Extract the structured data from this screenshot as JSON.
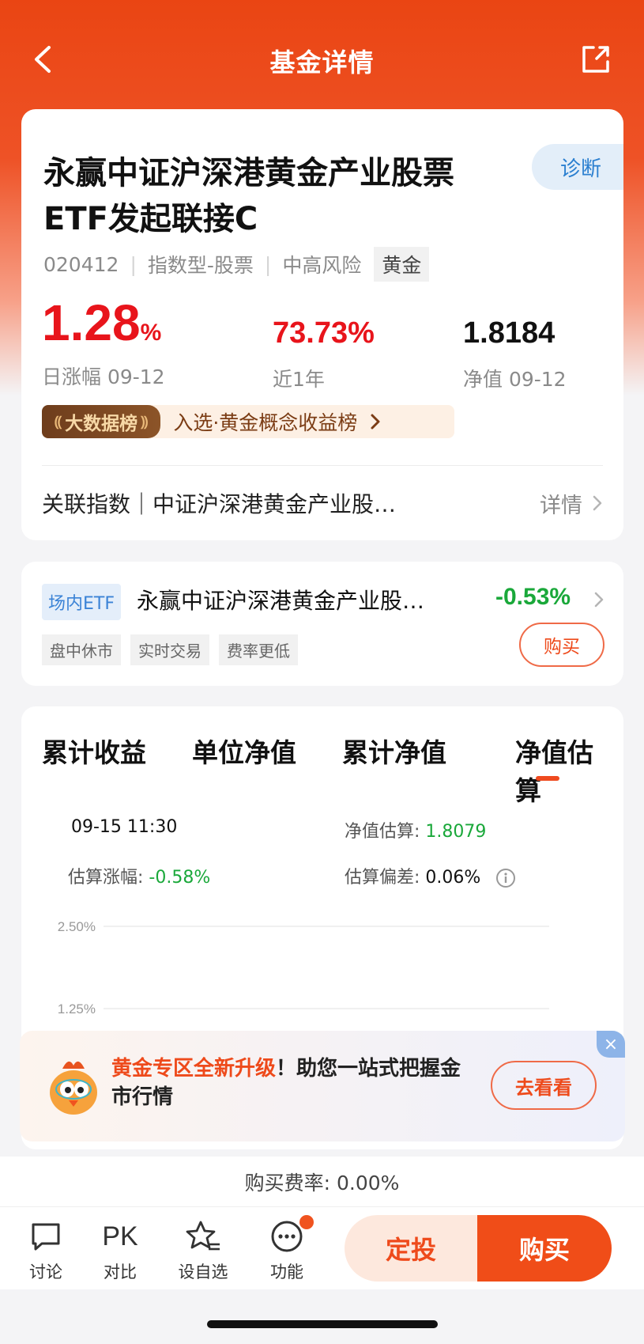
{
  "header": {
    "title": "基金详情"
  },
  "fund": {
    "name_line1": "永赢中证沪深港黄金产业股票",
    "name_line2": "ETF发起联接C",
    "diagnose": "诊断",
    "code": "020412",
    "type": "指数型-股票",
    "risk": "中高风险",
    "tag": "黄金",
    "daily_change": "1.28",
    "daily_change_unit": "%",
    "daily_label": "日涨幅 09-12",
    "year_return": "73.73%",
    "year_label": "近1年",
    "nav": "1.8184",
    "nav_label": "净值 09-12",
    "rank_badge": "大数据榜",
    "rank_text": "入选·黄金概念收益榜",
    "index_label": "关联指数｜中证沪深港黄金产业股…",
    "index_detail": "详情"
  },
  "etf": {
    "tag": "场内ETF",
    "name": "永赢中证沪深港黄金产业股…",
    "change": "-0.53%",
    "mini_tags": [
      "盘中休市",
      "实时交易",
      "费率更低"
    ],
    "buy": "购买"
  },
  "tabs": [
    "累计收益",
    "单位净值",
    "累计净值",
    "净值估算"
  ],
  "estimate": {
    "time": "09-15 11:30",
    "nav_label": "净值估算: ",
    "nav_value": "1.8079",
    "change_label": "估算涨幅: ",
    "change_value": "-0.58%",
    "dev_label": "估算偏差: ",
    "dev_value": "0.06%"
  },
  "chart_data": {
    "type": "line",
    "yticks": [
      "2.50%",
      "1.25%"
    ],
    "ylim": [
      0,
      2.5
    ],
    "grid": true,
    "series_color": "#1aa83a"
  },
  "promo": {
    "highlight": "黄金专区全新升级",
    "text": "！助您一站式把握金市行情",
    "button": "去看看",
    "close": "×"
  },
  "fee": "购买费率: 0.00%",
  "nav": {
    "discuss": "讨论",
    "compare_icon": "PK",
    "compare": "对比",
    "watchlist": "设自选",
    "functions": "功能",
    "dingtou": "定投",
    "buy": "购买"
  },
  "colors": {
    "brand": "#ee4a1b",
    "up": "#e8141b",
    "down": "#1aa83a"
  }
}
